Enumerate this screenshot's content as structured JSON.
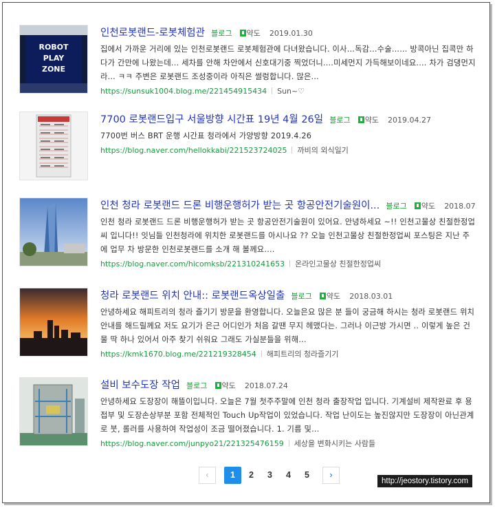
{
  "results": [
    {
      "title": "인천로봇랜드-로봇체험관",
      "category": "블로그",
      "map_label": "약도",
      "date": "2019.01.30",
      "desc": "집에서 가까운 거리에 있는 인천로봇랜드 로봇체험관에 다녀왔습니다. 이사...독감...수술...... 방콕아닌 집콕만 하다가 간만에 나왔는데... 세차를 안해 차안에서 신호대기중 찍었더니....미세먼지 가득해보이네요.... 차가 검댕먼지라... ㅋㅋ 주변은 로봇랜드 조성중이라 아직은 썰렁합니다. 많은...",
      "url": "https://sunsuk1004.blog.me/221454915434",
      "author": "Sun~♡",
      "thumb_text": [
        "ROBOT",
        "PLAY",
        "ZONE"
      ]
    },
    {
      "title": "7700 로봇랜드입구 서울방향 시간표 19년 4월 26일",
      "category": "블로그",
      "map_label": "약도",
      "date": "2019.04.27",
      "desc": "7700번 버스 BRT 운행 시간표 청라에서 가양방향 2019.4.26",
      "url": "https://blog.naver.com/hellokkabi/221523724025",
      "author": "까비의 외식일기"
    },
    {
      "title": "인천 청라 로봇랜드 드론 비행운행허가 받는 곳 항공안전기술원이...",
      "category": "블로그",
      "map_label": "약도",
      "date": "2018.07.02",
      "desc": "인천 청라 로봇랜드 드론 비행운행허가 받는 곳 항공안전기술원이 있어요. 안녕하세요 ~!! 인천고물상 친절한정업씨 입니다!! 잇님들 인천청라에 위치한 로봇랜드를 아시나요 ?? 오늘 인천고물상 친절한정업씨 포스팅은 지난 주에 업무 차 방문한 인천로봇랜드를 소개 해 볼께요....",
      "url": "https://blog.naver.com/hicomksb/221310241653",
      "author": "온라인고물상 친절한정업씨"
    },
    {
      "title": "청라 로봇랜드 위치 안내:: 로봇랜드옥상일출",
      "category": "블로그",
      "map_label": "약도",
      "date": "2018.03.01",
      "desc": "안녕하세요 해피트리의 청라 즐기기 방문을 환영합니다. 오늘은요 많은 분 들이 궁금해 하시는 청라 로봇랜드 위치안내를 해드릴께요 저도 요기가 은근 어디인가 처음 갈땐 무지 헤맸다는. 그러나 이근방 가시면 .. 이렇게 높은 건물 딱 하나 있어서 아주 찾기 쉬워요 그래도 가실분들을 위해...",
      "url": "https://kmk1670.blog.me/221219328454",
      "author": "해피트리의 청라즐기기"
    },
    {
      "title": "설비 보수도장 작업",
      "category": "블로그",
      "map_label": "약도",
      "date": "2018.07.24",
      "desc": "안녕하세요 도장장이 해뜰이입니다. 오늘은 7월 첫주주말에 인천 청라 출장작업 입니다. 기계설비 제작완료 후 용접부 및 도장손상부분 포함 전체적인 Touch Up작업이 있었습니다. 작업 난이도는 높진않지만 도장장이 아닌관계로 붓, 롤러를 사용하여 작업성이 조금 떨어졌습니다. 1. 기름 및...",
      "url": "https://blog.naver.com/junpyo21/221325476159",
      "author": "세상을 변화시키는 사람들"
    }
  ],
  "pagination": {
    "prev": "‹",
    "pages": [
      "1",
      "2",
      "3",
      "4",
      "5"
    ],
    "active_page": "1",
    "next": "›"
  },
  "watermark": "http://jeostory.tistory.com",
  "colors": {
    "title": "#2233bb",
    "url": "#149c3c",
    "tag": "#11a030",
    "active_page": "#1e8ee8"
  }
}
